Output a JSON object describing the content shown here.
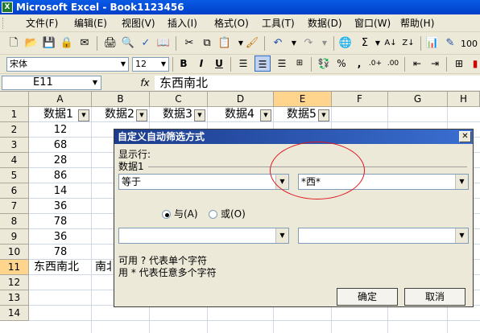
{
  "window": {
    "title": "Microsoft Excel - Book1123456",
    "app_icon": "excel-icon"
  },
  "menu": [
    "文件(F)",
    "编辑(E)",
    "视图(V)",
    "插入(I)",
    "格式(O)",
    "工具(T)",
    "数据(D)",
    "窗口(W)",
    "帮助(H)"
  ],
  "format_toolbar": {
    "font": "宋体",
    "size": "12",
    "bold": "B",
    "italic": "I",
    "underline": "U",
    "percent": "%",
    "comma": ",",
    "zoom": "100"
  },
  "formula_bar": {
    "name_box": "E11",
    "fx": "fx",
    "content": "东西南北"
  },
  "columns": [
    "A",
    "B",
    "C",
    "D",
    "E",
    "F",
    "G",
    "H"
  ],
  "rows": [
    "1",
    "2",
    "3",
    "4",
    "5",
    "6",
    "7",
    "8",
    "9",
    "10",
    "11",
    "12",
    "13",
    "14"
  ],
  "headers": [
    "数据1",
    "数据2",
    "数据3",
    "数据4",
    "数据5"
  ],
  "column_a_values": [
    "12",
    "68",
    "28",
    "86",
    "14",
    "36",
    "78",
    "36",
    "78"
  ],
  "row11": {
    "a": "东西南北",
    "b": "南北"
  },
  "dialog": {
    "title": "自定义自动筛选方式",
    "show_rows_label": "显示行:",
    "field_label": "数据1",
    "operator1": "等于",
    "value1": "*西*",
    "and_label": "与(A)",
    "or_label": "或(O)",
    "operator2": "",
    "value2": "",
    "hint1": "可用 ? 代表单个字符",
    "hint2": "用 * 代表任意多个字符",
    "ok_label": "确定",
    "cancel_label": "取消",
    "close_glyph": "✕"
  },
  "colors": {
    "title_bar": "#0a5ae6",
    "selected_header": "#ffd58d",
    "annotation": "#e0141e"
  }
}
